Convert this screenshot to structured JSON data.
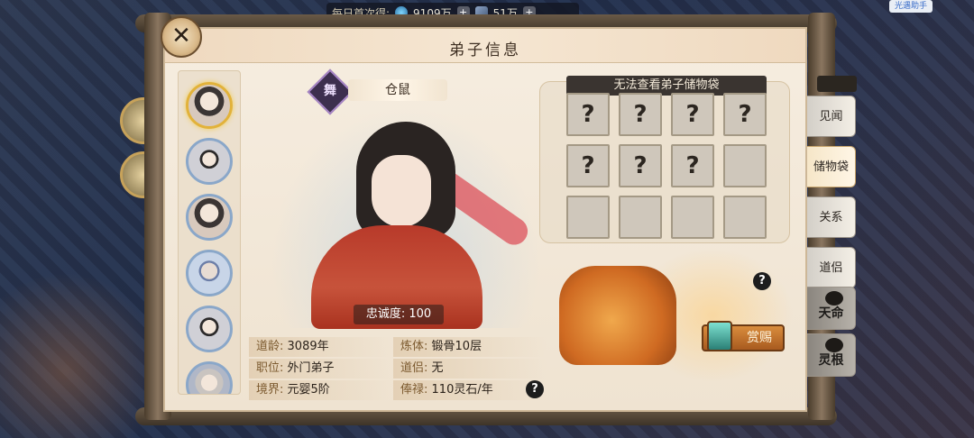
{
  "topbar": {
    "daily_label": "每日首次得:",
    "currency1_value": "9109万",
    "currency2_value": "51万",
    "helper": "光遇助手"
  },
  "panel": {
    "title": "弟子信息",
    "close_icon": "close-icon"
  },
  "disciple": {
    "rank_badge": "舞",
    "name": "仓鼠",
    "loyalty": "忠诚度: 100"
  },
  "info": {
    "rows": [
      {
        "k1": "道龄:",
        "v1": "3089年",
        "k2": "炼体:",
        "v2": "锻骨10层"
      },
      {
        "k1": "职位:",
        "v1": "外门弟子",
        "k2": "道侣:",
        "v2": "无"
      },
      {
        "k1": "境界:",
        "v1": "元婴5阶",
        "k2": "俸禄:",
        "v2": "110灵石/年"
      }
    ]
  },
  "bag": {
    "header": "无法查看弟子储物袋",
    "slot_char": "?",
    "slots_known": 7,
    "slots_total": 12
  },
  "reward": {
    "button_label": "赏赐"
  },
  "tabs": [
    {
      "label": "见闻",
      "active": false
    },
    {
      "label": "储物袋",
      "active": true
    },
    {
      "label": "关系",
      "active": false
    },
    {
      "label": "道侣",
      "active": false
    },
    {
      "label": "天命",
      "active": false
    },
    {
      "label": "灵根",
      "active": false
    }
  ],
  "help_icon": "question-icon"
}
